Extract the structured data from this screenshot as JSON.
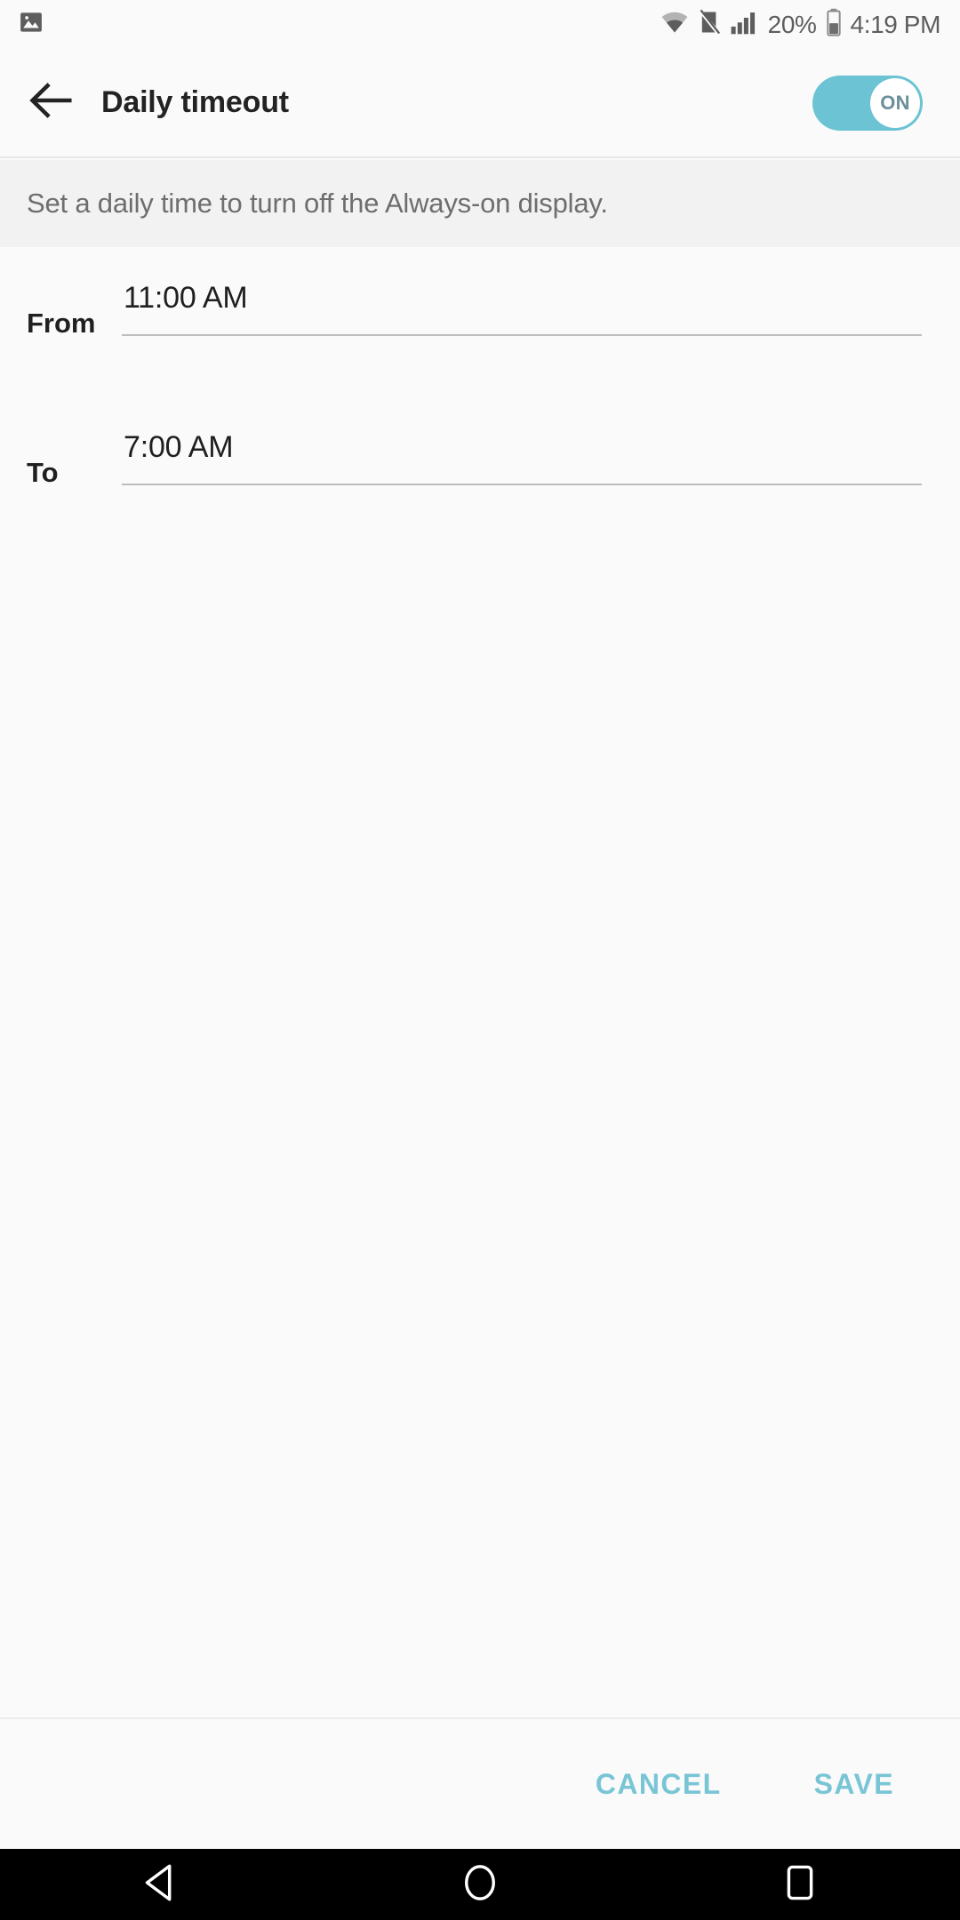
{
  "status_bar": {
    "notification_icons": [
      {
        "name": "image-notification-icon",
        "glyph": "image"
      }
    ],
    "system_icons": [
      {
        "name": "wifi-icon",
        "glyph": "wifi"
      },
      {
        "name": "nfc-off-icon",
        "glyph": "nfc-off"
      },
      {
        "name": "signal-icon",
        "glyph": "signal-bars"
      }
    ],
    "battery_percent": "20%",
    "battery_icon": "battery-low-icon",
    "clock": "4:19 PM"
  },
  "action_bar": {
    "back_icon": "back-arrow-icon",
    "title": "Daily timeout",
    "toggle": {
      "state_label": "ON",
      "is_on": true
    }
  },
  "description": {
    "text": "Set a daily time to turn off the Always-on display."
  },
  "form": {
    "rows": [
      {
        "label": "From",
        "value": "11:00 AM"
      },
      {
        "label": "To",
        "value": "7:00 AM"
      }
    ]
  },
  "bottom_bar": {
    "cancel_label": "CANCEL",
    "save_label": "SAVE"
  },
  "navigation_bar": {
    "back_label": "back",
    "home_label": "home",
    "recents_label": "recents"
  },
  "colors": {
    "accent_teal": "#6bc3d4",
    "button_teal": "#79c5d6",
    "page_background": "#fafafa",
    "description_background": "#f2f2f2",
    "primary_text": "#1f1f1f",
    "secondary_text": "#6e6e6e",
    "status_text": "#5d5d5d",
    "nav_background": "#000000"
  }
}
